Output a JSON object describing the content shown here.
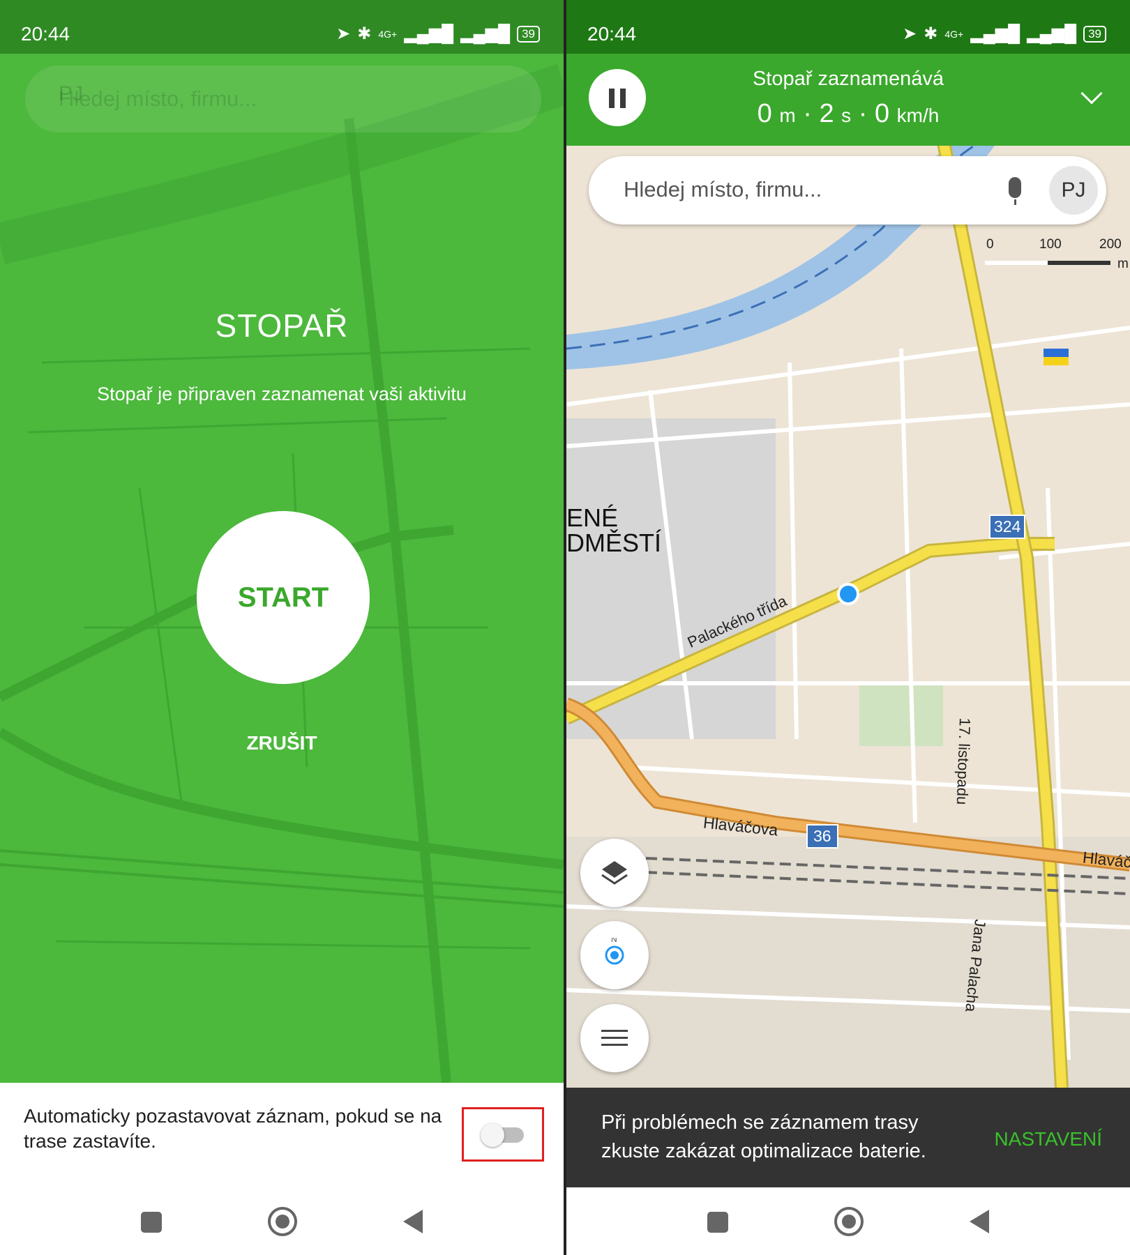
{
  "status_left": {
    "time": "20:44",
    "network": "4G+",
    "battery": "39"
  },
  "status_right": {
    "time": "20:44",
    "network": "4G+",
    "battery": "39"
  },
  "left": {
    "search_placeholder": "Hledej místo, firmu...",
    "avatar": "PJ",
    "title": "STOPAŘ",
    "subtitle": "Stopař je připraven zaznamenat vaši aktivitu",
    "start_label": "START",
    "cancel_label": "ZRUŠIT",
    "autopause_text": "Automaticky pozastavovat záznam, pokud se na trase zastavíte.",
    "autopause_enabled": false
  },
  "right": {
    "rec_title": "Stopař zaznamenává",
    "distance_value": "0",
    "distance_unit": "m",
    "time_value": "2",
    "time_unit": "s",
    "speed_value": "0",
    "speed_unit": "km/h",
    "search_placeholder": "Hledej místo, firmu...",
    "avatar": "PJ",
    "scale": {
      "s0": "0",
      "s1": "100",
      "s2": "200",
      "unit": "m"
    },
    "map_labels": {
      "district_1": "ENÉ",
      "district_2": "DMĚSTÍ",
      "street_palackeho": "Palackého třída",
      "street_hlavacova": "Hlaváčova",
      "street_hlavac_edge": "Hlaváč",
      "street_17": "17. listopadu",
      "street_jana": "Jana Palacha",
      "road_324": "324",
      "road_36": "36"
    },
    "snackbar_text": "Při problémech se záznamem trasy zkuste zakázat optimalizace baterie.",
    "snackbar_action": "NASTAVENÍ"
  },
  "colors": {
    "green": "#3aa82c",
    "dark_green": "#1e7814",
    "accent_text": "#39c12a",
    "road_yellow": "#f5e04a",
    "road_orange": "#f2b25c"
  }
}
